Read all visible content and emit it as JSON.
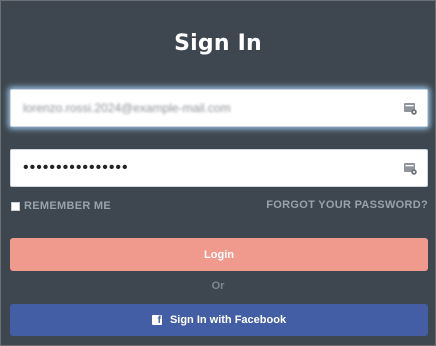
{
  "heading": "Sign In",
  "email_field": {
    "value": "lorenzo.rossi.2024@example-mail.com",
    "icon": "password-manager-key-icon"
  },
  "password_field": {
    "value": "••••••••••••••••",
    "icon": "password-manager-key-icon"
  },
  "remember": {
    "label": "REMEMBER ME",
    "checked": false
  },
  "forgot": {
    "label": "FORGOT YOUR PASSWORD?"
  },
  "login_button": {
    "label": "Login",
    "color": "#ef9a8c"
  },
  "separator": "Or",
  "facebook_button": {
    "label": "Sign In with Facebook",
    "icon": "facebook-icon",
    "color": "#435ea4"
  },
  "colors": {
    "background": "#3e474f",
    "muted_text": "#99a2aa"
  }
}
